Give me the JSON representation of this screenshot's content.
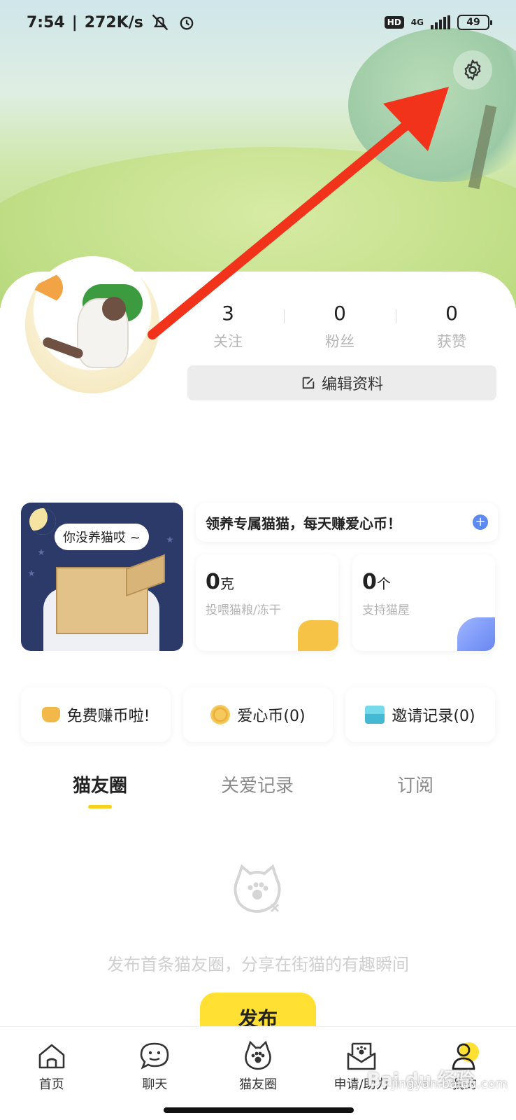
{
  "status_bar": {
    "time": "7:54",
    "speed": "272K/s",
    "hd": "HD",
    "network": "4G",
    "battery": "49"
  },
  "profile": {
    "stats": [
      {
        "value": "3",
        "label": "关注"
      },
      {
        "value": "0",
        "label": "粉丝"
      },
      {
        "value": "0",
        "label": "获赞"
      }
    ],
    "edit_label": "编辑资料"
  },
  "adopt": {
    "bubble_text": "你没养猫哎 ~",
    "banner_text": "领养专属猫猫，每天赚爱心币！",
    "plus": "+",
    "food": {
      "value": "0",
      "unit": "克",
      "label": "投喂猫粮/冻干"
    },
    "house": {
      "value": "0",
      "unit": "个",
      "label": "支持猫屋"
    }
  },
  "actions": [
    {
      "label": "免费赚币啦!",
      "icon": "hand-coin-icon"
    },
    {
      "label": "爱心币(0)",
      "icon": "coin-icon"
    },
    {
      "label": "邀请记录(0)",
      "icon": "gift-icon"
    }
  ],
  "tabs": [
    "猫友圈",
    "关爱记录",
    "订阅"
  ],
  "active_tab": 0,
  "empty_state": {
    "text": "发布首条猫友圈，分享在街猫的有趣瞬间",
    "button": "发布"
  },
  "bottom_nav": [
    {
      "label": "首页",
      "icon": "home-icon"
    },
    {
      "label": "聊天",
      "icon": "chat-icon"
    },
    {
      "label": "猫友圈",
      "icon": "paw-circle-icon"
    },
    {
      "label": "申请/助力",
      "icon": "apply-icon"
    },
    {
      "label": "我的",
      "icon": "profile-icon"
    }
  ],
  "watermark": {
    "logo": "Bai du 经验",
    "url": "jingyan.baidu.com"
  },
  "colors": {
    "accent_yellow": "#ffe033",
    "tab_underline": "#f7d21b",
    "arrow_red": "#f0331a"
  }
}
